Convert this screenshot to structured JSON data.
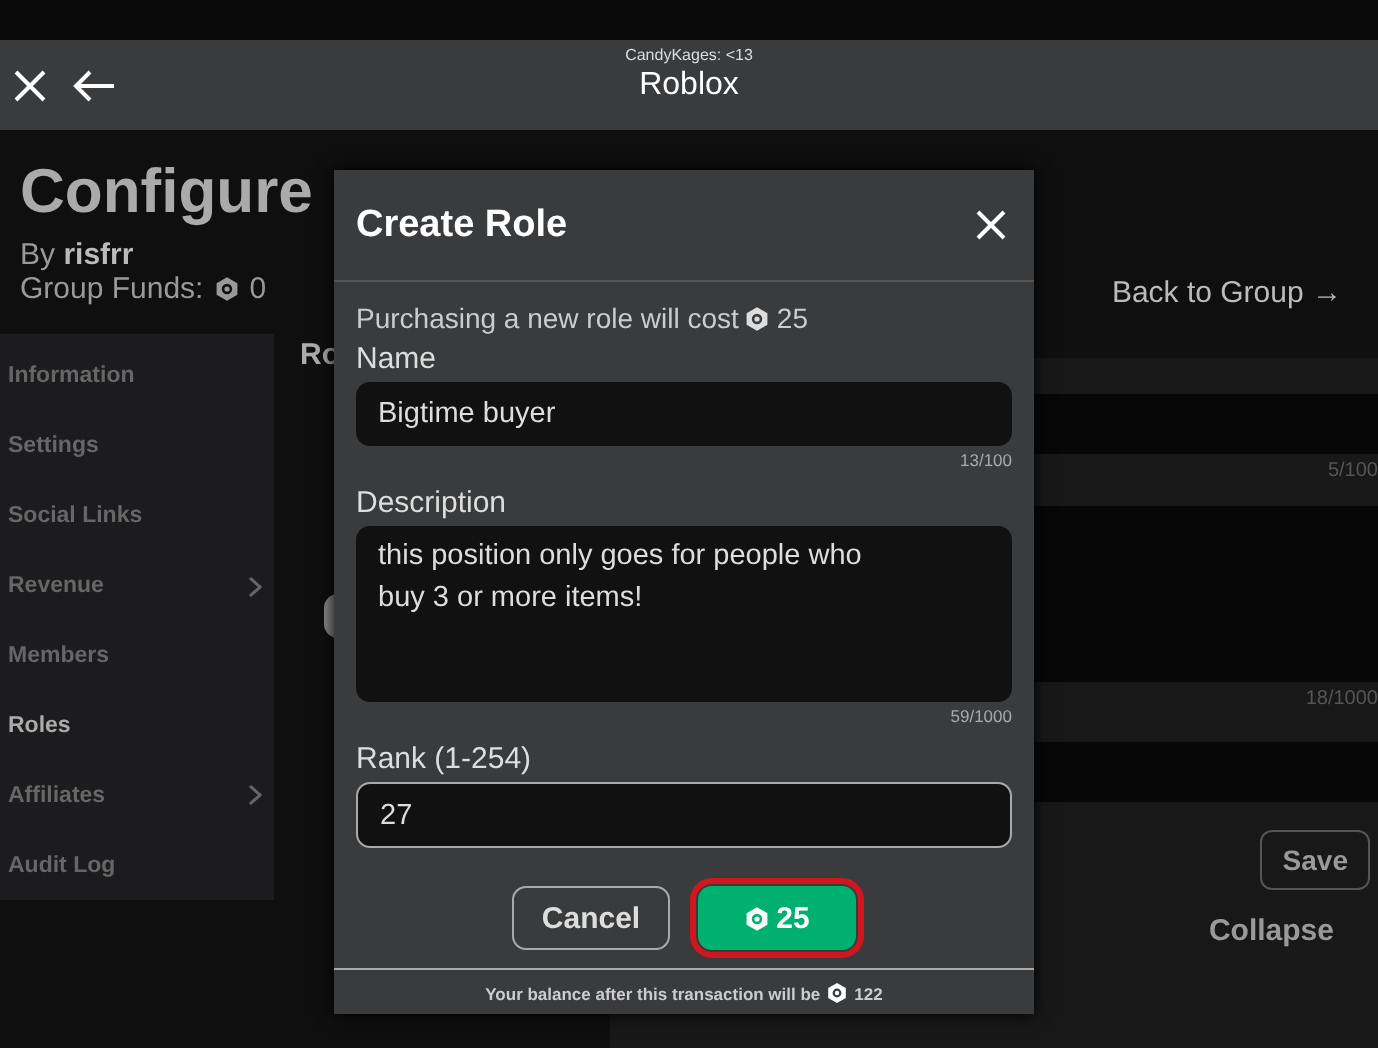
{
  "app_bar": {
    "account": "CandyKages: <13",
    "title": "Roblox"
  },
  "page": {
    "title": "Configure",
    "owner": "By **risfrr**",
    "funds_label": "Group Funds:",
    "funds": "0",
    "back_link": "Back to Group →"
  },
  "sidebar": {
    "items": [
      {
        "label": "Information",
        "selected": false,
        "expandable": false
      },
      {
        "label": "Settings",
        "selected": false,
        "expandable": false
      },
      {
        "label": "Social Links",
        "selected": false,
        "expandable": false
      },
      {
        "label": "Revenue",
        "selected": false,
        "expandable": true
      },
      {
        "label": "Members",
        "selected": false,
        "expandable": false
      },
      {
        "label": "Roles",
        "selected": true,
        "expandable": false
      },
      {
        "label": "Affiliates",
        "selected": false,
        "expandable": true
      },
      {
        "label": "Audit Log",
        "selected": false,
        "expandable": false
      }
    ]
  },
  "roles_heading": "Ro",
  "right_panel": {
    "name_counter": "5/100",
    "description_counter": "18/1000",
    "save": "Save",
    "collapse": "Collapse"
  },
  "dialog": {
    "title": "Create Role",
    "cost_text": "Purchasing a new role will cost",
    "cost": "25",
    "name": {
      "label": "Name",
      "value": "Bigtime buyer",
      "counter": "13/100"
    },
    "description": {
      "label": "Description",
      "value": "this position only goes for people who buy 3 or more items!",
      "counter": "59/1000"
    },
    "rank": {
      "label": "Rank (1-254)",
      "value": "27"
    },
    "cancel": "Cancel",
    "confirm": {
      "amount": "25",
      "focused": true
    },
    "balance_text": "Your balance after this transaction will be",
    "balance": "122"
  }
}
